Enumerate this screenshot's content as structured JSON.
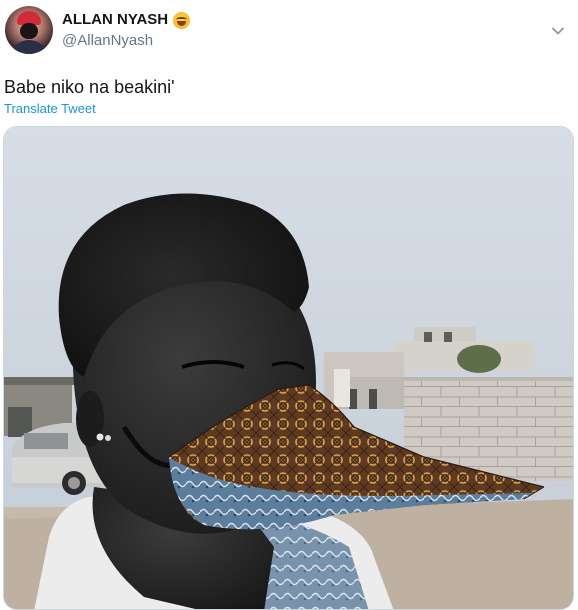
{
  "tweet": {
    "display_name": "ALLAN NYASH",
    "handle": "@AllanNyash",
    "text": "Babe niko na beakini'",
    "translate_label": "Translate Tweet",
    "name_emoji": "tears-of-joy-emoji",
    "menu_icon": "chevron-down-icon"
  },
  "media": {
    "icon": "photo",
    "accent_color": "#1b95e0"
  }
}
